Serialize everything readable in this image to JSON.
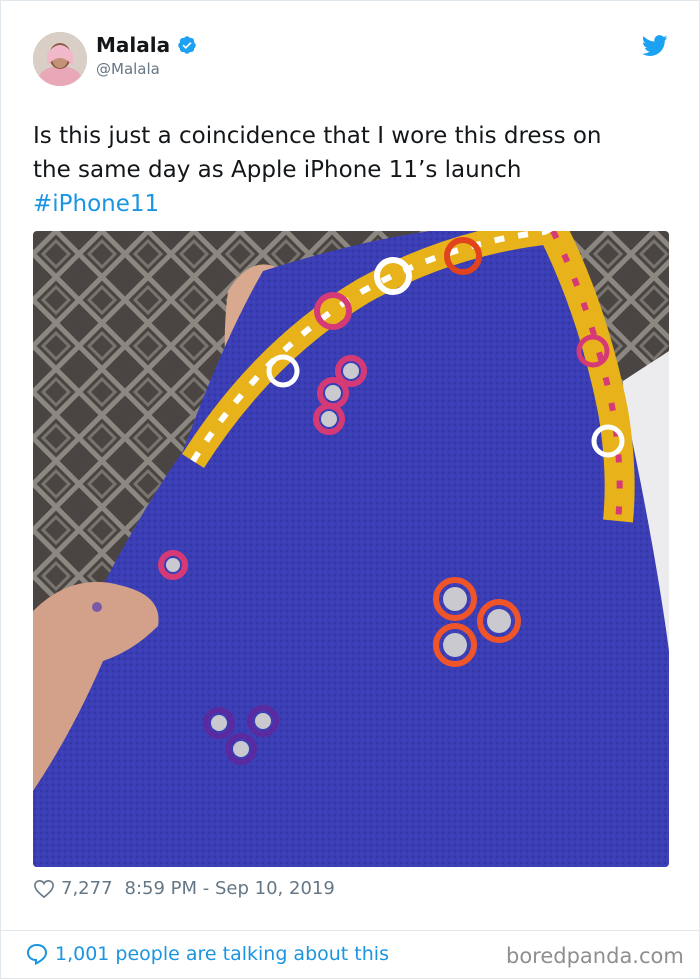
{
  "tweet": {
    "author_name": "Malala",
    "author_handle": "@Malala",
    "text_lines": [
      "Is this just a coincidence that I wore this dress on",
      "the same day as Apple iPhone 11’s launch"
    ],
    "hashtag": "#iPhone11",
    "likes": "7,277",
    "timestamp": "8:59 PM - Sep 10, 2019",
    "talking": "1,001 people are talking about this"
  },
  "icons": {
    "verified": "verified-badge-icon",
    "bird": "twitter-bird-icon",
    "heart": "heart-outline-icon",
    "bubble": "speech-bubble-icon"
  },
  "colors": {
    "link_blue": "#1b95e0",
    "muted_gray": "#657786",
    "dress_blue": "#3a3fb8"
  },
  "watermark": "boredpanda.com"
}
